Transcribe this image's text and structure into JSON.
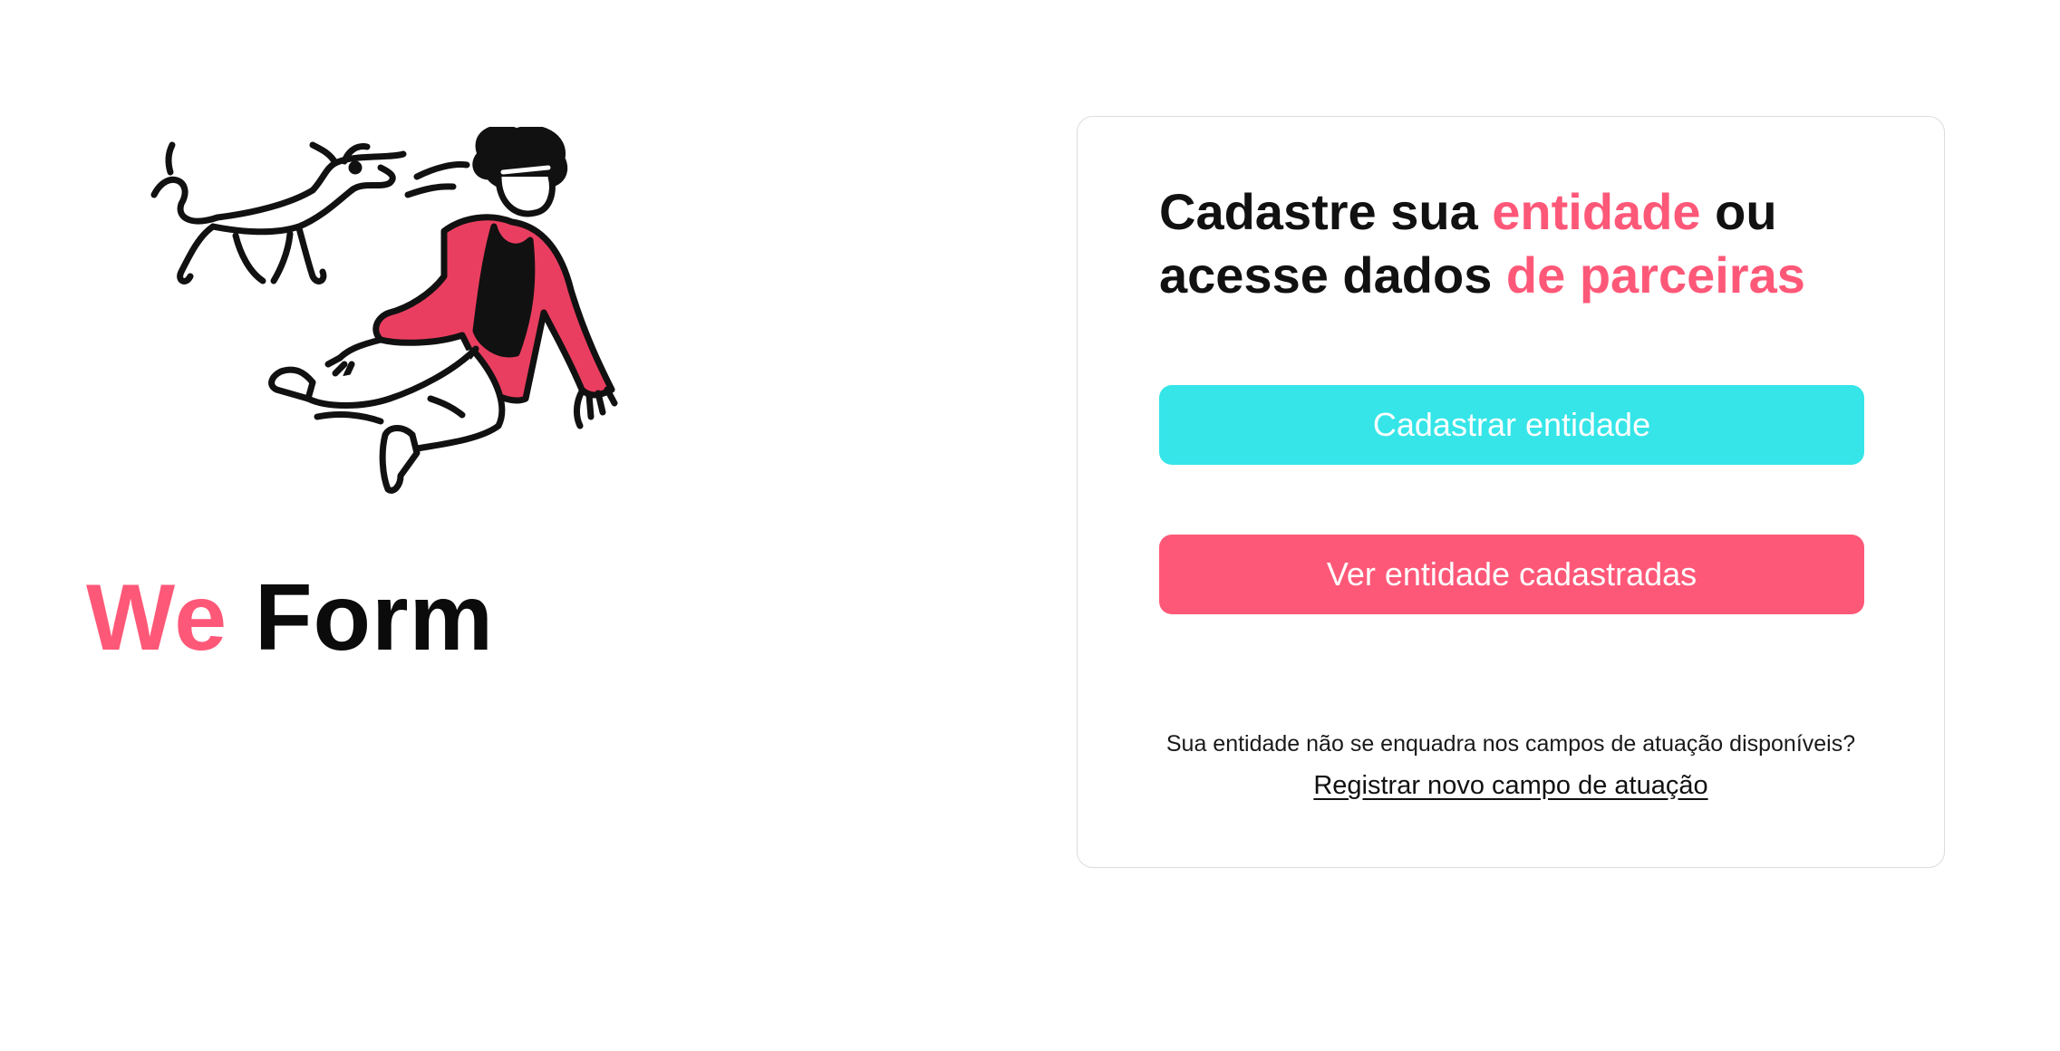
{
  "brand": {
    "logo_part1": "We",
    "logo_part2": "Form",
    "illustration_icon": "running-person-with-dog-illustration"
  },
  "card": {
    "headline": {
      "part1": "Cadastre sua ",
      "accent1": "entidade",
      "part2": " ou",
      "part3": "acesse dados ",
      "accent2": "de parceiras"
    },
    "primary_button": "Cadastrar entidade",
    "secondary_button": "Ver entidade cadastradas",
    "question": "Sua entidade não se enquadra nos campos de atuação disponíveis?",
    "register_link": "Registrar novo campo de atuação"
  },
  "colors": {
    "accent_pink": "#fe5878",
    "accent_cyan": "#35e5e8",
    "text_dark": "#111111",
    "card_border": "#dcdcdc"
  }
}
